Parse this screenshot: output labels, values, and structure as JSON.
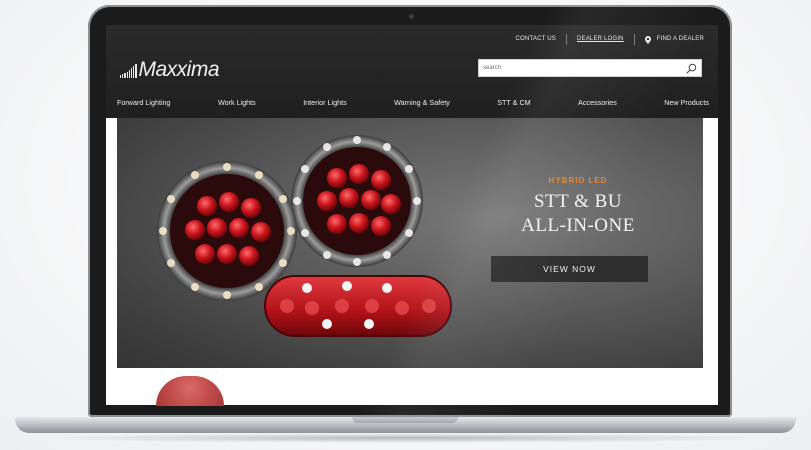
{
  "utility": {
    "contact": "CONTACT US",
    "dealer_login": "DEALER LOGIN",
    "find_dealer": "FIND A DEALER"
  },
  "brand": {
    "name": "Maxxima"
  },
  "search": {
    "placeholder": "search"
  },
  "nav": [
    {
      "label": "Forward Lighting"
    },
    {
      "label": "Work Lights"
    },
    {
      "label": "Interior Lights"
    },
    {
      "label": "Warning & Safety"
    },
    {
      "label": "STT & CM"
    },
    {
      "label": "Accessories"
    },
    {
      "label": "New Products"
    }
  ],
  "hero": {
    "kicker": "HYBRID LED",
    "title_line1": "STT & BU",
    "title_line2": "ALL-IN-ONE",
    "cta": "VIEW NOW"
  },
  "colors": {
    "header_bg": "#222222",
    "accent_orange": "#e8842a",
    "led_red": "#c8151d"
  },
  "icons": [
    "location-pin-icon",
    "search-icon",
    "logo-bars-icon"
  ]
}
